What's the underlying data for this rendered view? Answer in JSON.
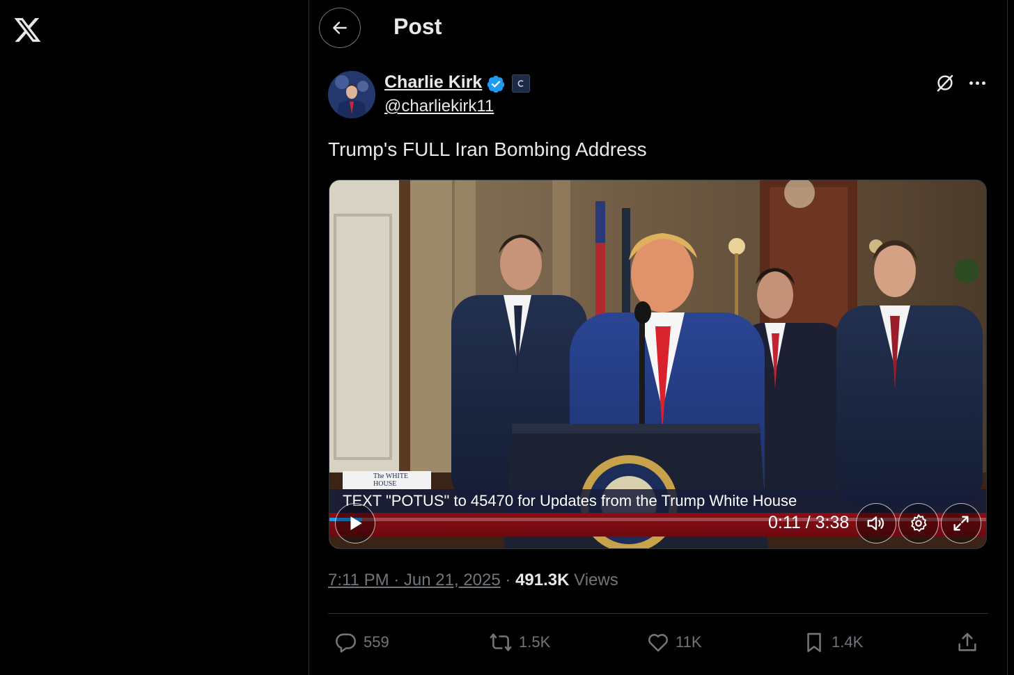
{
  "header": {
    "title": "Post"
  },
  "post": {
    "author_name": "Charlie Kirk",
    "handle": "@charliekirk11",
    "text": "Trump's FULL Iran Bombing Address",
    "timestamp": "7:11 PM · Jun 21, 2025",
    "views_count": "491.3K",
    "views_label": "Views"
  },
  "video": {
    "source_label": "The WHITE HOUSE",
    "chyron": "TEXT \"POTUS\" to 45470 for Updates from the Trump White House",
    "time_readout": "0:11 / 3:38",
    "progress": 0.05
  },
  "actions": {
    "replies": "559",
    "reposts": "1.5K",
    "likes": "11K",
    "bookmarks": "1.4K"
  },
  "colors": {
    "background": "#000000",
    "text": "#e7e9ea",
    "muted": "#71767b",
    "border": "#2f3336",
    "verified": "#1d9bf0"
  }
}
